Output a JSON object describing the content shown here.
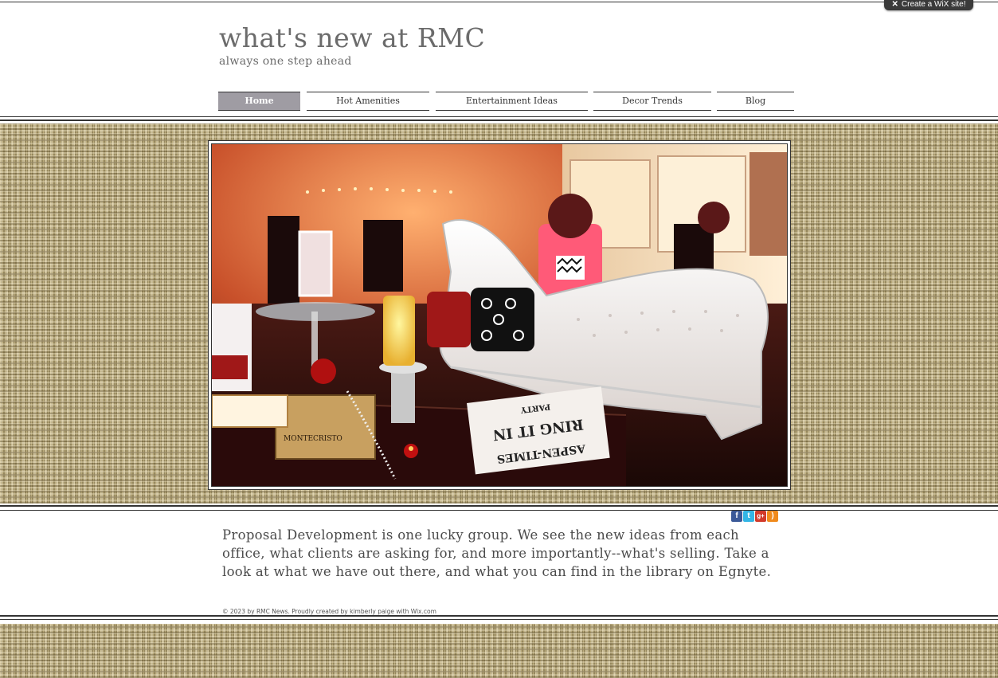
{
  "wix_badge": {
    "label": "Create a WiX site!"
  },
  "header": {
    "title": "what's new at RMC",
    "tagline": "always one step ahead"
  },
  "nav": {
    "items": [
      {
        "label": "Home",
        "active": true
      },
      {
        "label": "Hot Amenities"
      },
      {
        "label": "Entertainment Ideas"
      },
      {
        "label": "Decor Trends"
      },
      {
        "label": "Blog"
      }
    ]
  },
  "hero": {
    "image_description": "event lounge with white tufted chaise",
    "cigar_box_label": "MONTECRISTO",
    "newspaper": {
      "masthead": "ASPEN-TIMES",
      "headline": "RING IT IN",
      "subhead": "PARTY"
    }
  },
  "social": {
    "icons": [
      "facebook-icon",
      "twitter-icon",
      "google-plus-icon",
      "rss-icon"
    ],
    "colors": {
      "facebook": "#3b5998",
      "twitter": "#33b5e5",
      "google_plus": "#d23a2b",
      "rss": "#f08a1c"
    }
  },
  "content": {
    "paragraph": "Proposal Development is one lucky group. We see the new ideas from each office, what clients are asking for, and more importantly--what's selling. Take a look at what we have out there, and what you can find in the library on Egnyte."
  },
  "footer": {
    "text": "© 2023 by RMC News. Proudly created by kimberly paige with Wix.com"
  },
  "colors": {
    "title_gray": "#6b6b6b",
    "nav_active_bg": "#9f9ca3",
    "burlap": "#b9a97a"
  }
}
